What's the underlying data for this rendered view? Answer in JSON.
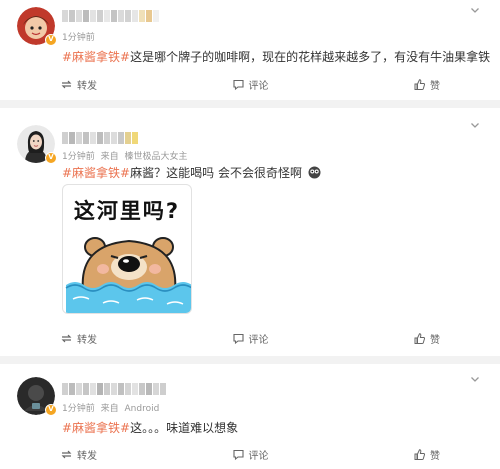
{
  "comments": [
    {
      "time": "1分钟前",
      "topic": "#麻酱拿铁#",
      "text": "这是哪个牌子的咖啡啊，现在的花样越来越多了，有没有牛油果拿铁",
      "actions": {
        "repost": "转发",
        "comment": "评论",
        "like": "赞"
      },
      "username_colors": [
        "#d8d8d8",
        "#c8c8c8",
        "#dcdcdc",
        "#bcbcbc",
        "#e2e2e2",
        "#cfcfcf",
        "#e8e8e8",
        "#c4c4c4",
        "#dadada",
        "#d2d2d2",
        "#e6e6e6",
        "#f0e0b8",
        "#e8c890",
        "#f0f0f0"
      ]
    },
    {
      "time": "1分钟前",
      "source_prefix": "来自",
      "source": "榛世极品大女主",
      "topic": "#麻酱拿铁#",
      "text": "麻酱？这能喝吗 会不会很奇怪啊",
      "sticker_text": "这河里吗?",
      "actions": {
        "repost": "转发",
        "comment": "评论",
        "like": "赞"
      },
      "username_colors": [
        "#cfcfcf",
        "#b8b8b8",
        "#d6d6d6",
        "#c2c2c2",
        "#e0e0e0",
        "#bdbdbd",
        "#d0d0d0",
        "#dcdcdc",
        "#c8c8c8",
        "#e4d090",
        "#f0d878"
      ]
    },
    {
      "time": "1分钟前",
      "source_prefix": "来自",
      "source": "Android",
      "topic": "#麻酱拿铁#",
      "text": "这。。。味道难以想象",
      "actions": {
        "repost": "转发",
        "comment": "评论",
        "like": "赞"
      },
      "username_colors": [
        "#d0d0d0",
        "#bcbcbc",
        "#d8d8d8",
        "#c6c6c6",
        "#e0e0e0",
        "#b4b4b4",
        "#cccccc",
        "#dadada",
        "#c0c0c0",
        "#d4d4d4",
        "#e2e2e2",
        "#c8c8c8",
        "#b8b8b8",
        "#d6d6d6",
        "#cecece"
      ]
    }
  ],
  "colors": {
    "topic": "#eb7350",
    "badge": "#f5a623",
    "meta": "#999999"
  },
  "icons": {
    "repost": "repost-icon",
    "comment": "comment-icon",
    "like": "thumb-up-icon",
    "menu": "chevron-down-icon",
    "badge": "verified-v-icon"
  }
}
